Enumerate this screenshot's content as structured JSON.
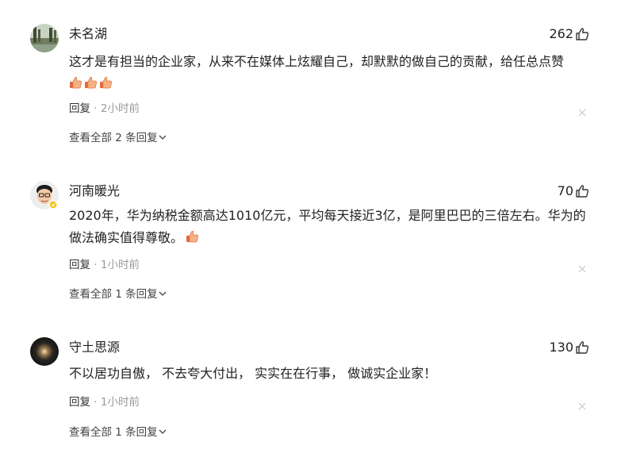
{
  "comments": [
    {
      "username": "未名湖",
      "likes": "262",
      "content": "这才是有担当的企业家，从来不在媒体上炫耀自己，却默默的做自己的贡献，给任总点赞",
      "emoji_count": 3,
      "reply_label": "回复",
      "separator": "·",
      "time": "2小时前",
      "view_replies": "查看全部 2 条回复"
    },
    {
      "username": "河南暖光",
      "likes": "70",
      "content": "2020年，华为纳税金额高达1010亿元，平均每天接近3亿，是阿里巴巴的三倍左右。华为的做法确实值得尊敬。",
      "emoji_count": 1,
      "reply_label": "回复",
      "separator": "·",
      "time": "1小时前",
      "view_replies": "查看全部 1 条回复"
    },
    {
      "username": "守土思源",
      "likes": "130",
      "content": "不以居功自傲， 不去夸大付出， 实实在在行事， 做诚实企业家！",
      "emoji_count": 0,
      "reply_label": "回复",
      "separator": "·",
      "time": "1小时前",
      "view_replies": "查看全部 1 条回复"
    }
  ],
  "icons": {
    "like": "thumbs-up-icon",
    "emoji": "thumbs-up-emoji-icon",
    "close": "close-icon",
    "expand": "chevron-down-icon"
  },
  "colors": {
    "text": "#222222",
    "meta": "#999999",
    "emoji": "#f0a070"
  }
}
